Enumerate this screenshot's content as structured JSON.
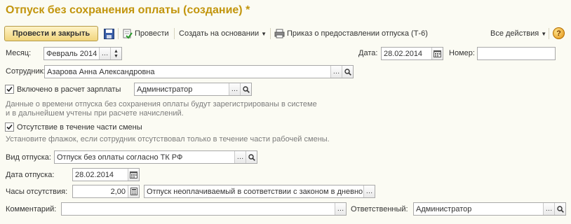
{
  "title": "Отпуск без сохранения оплаты (создание) *",
  "toolbar": {
    "post_close": "Провести и закрыть",
    "post": "Провести",
    "create_based": "Создать на основании",
    "print_order": "Приказ о предоставлении отпуска (Т-6)",
    "all_actions": "Все действия",
    "help": "?"
  },
  "form": {
    "month_label": "Месяц:",
    "month_value": "Февраль 2014",
    "date_label": "Дата:",
    "date_value": "28.02.2014",
    "number_label": "Номер:",
    "number_value": "",
    "employee_label": "Сотрудник:",
    "employee_value": "Азарова Анна Александровна",
    "payroll_checkbox_label": "Включено в расчет зарплаты",
    "payroll_checked": true,
    "payroll_user_value": "Администратор",
    "payroll_hint_line1": "Данные о времени отпуска без сохранения оплаты будут зарегистрированы в системе",
    "payroll_hint_line2": "и в дальнейшем учтены при расчете начислений.",
    "partial_checkbox_label": "Отсутствие в течение части смены",
    "partial_checked": true,
    "partial_hint": "Установите флажок, если сотрудник отсутствовал только в течение части рабочей смены.",
    "leave_type_label": "Вид отпуска:",
    "leave_type_value": "Отпуск без оплаты согласно ТК РФ",
    "leave_date_label": "Дата отпуска:",
    "leave_date_value": "28.02.2014",
    "hours_label": "Часы отсутствия:",
    "hours_value": "2,00",
    "absence_kind_value": "Отпуск неоплачиваемый в соответствии с законом в дневно",
    "comment_label": "Комментарий:",
    "comment_value": "",
    "responsible_label": "Ответственный:",
    "responsible_value": "Администратор"
  },
  "colors": {
    "title": "#c2950d",
    "background": "#fbfbf3",
    "hint": "#7c7c7c"
  }
}
